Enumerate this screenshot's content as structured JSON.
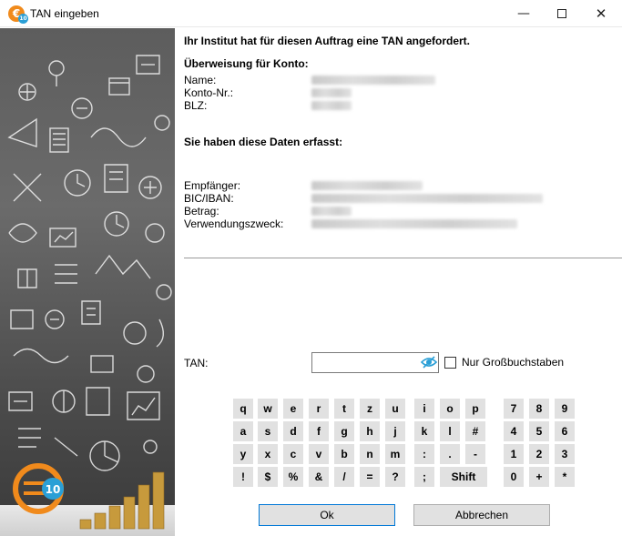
{
  "window": {
    "title": "TAN eingeben",
    "minimize_glyph": "—",
    "close_glyph": "✕"
  },
  "logo": {
    "main": "€",
    "badge": "10"
  },
  "header": {
    "request": "Ihr Institut hat für diesen Auftrag eine TAN angefordert.",
    "account_heading": "Überweisung für Konto:",
    "captured_heading": "Sie haben diese Daten erfasst:"
  },
  "account": {
    "name_label": "Name:",
    "number_label": "Konto-Nr.:",
    "blz_label": "BLZ:"
  },
  "transfer": {
    "recipient_label": "Empfänger:",
    "bic_iban_label": "BIC/IBAN:",
    "amount_label": "Betrag:",
    "purpose_label": "Verwendungszweck:"
  },
  "tan": {
    "label": "TAN:",
    "value": "",
    "uppercase_label": "Nur Großbuchstaben",
    "uppercase_checked": false
  },
  "keyboard": {
    "rows": [
      [
        "q",
        "w",
        "e",
        "r",
        "t",
        "z",
        "u",
        "i",
        "o",
        "p"
      ],
      [
        "a",
        "s",
        "d",
        "f",
        "g",
        "h",
        "j",
        "k",
        "l",
        "#"
      ],
      [
        "y",
        "x",
        "c",
        "v",
        "b",
        "n",
        "m",
        ":",
        ".",
        "-"
      ],
      [
        "!",
        "$",
        "%",
        "&",
        "/",
        "=",
        "?",
        ";",
        "Shift"
      ]
    ],
    "numpad": [
      [
        "7",
        "8",
        "9"
      ],
      [
        "4",
        "5",
        "6"
      ],
      [
        "1",
        "2",
        "3"
      ],
      [
        "0",
        "+",
        "*"
      ]
    ]
  },
  "buttons": {
    "ok": "Ok",
    "cancel": "Abbrechen"
  },
  "colors": {
    "accent": "#0078d7",
    "logo_orange": "#f08a1c",
    "logo_blue": "#2a9fd6",
    "eye_icon": "#2a9fd6"
  }
}
